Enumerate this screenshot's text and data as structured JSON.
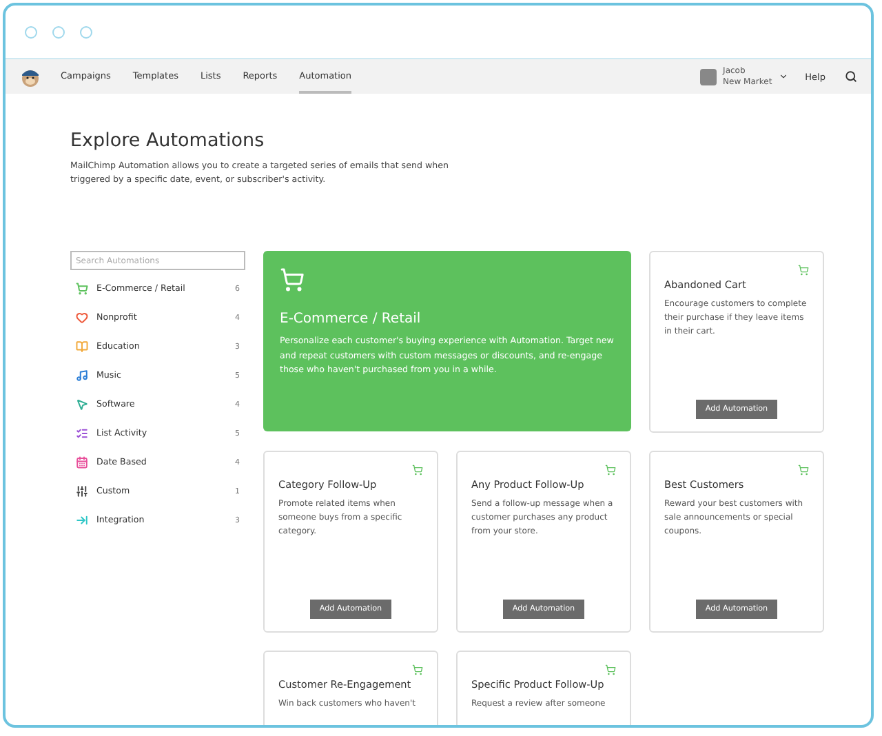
{
  "nav": {
    "items": [
      {
        "label": "Campaigns",
        "selected": false
      },
      {
        "label": "Templates",
        "selected": false
      },
      {
        "label": "Lists",
        "selected": false
      },
      {
        "label": "Reports",
        "selected": false
      },
      {
        "label": "Automation",
        "selected": true
      }
    ],
    "user": {
      "name": "Jacob",
      "org": "New Market"
    },
    "help": "Help"
  },
  "page": {
    "title": "Explore Automations",
    "description": "MailChimp Automation allows you to create a targeted series of emails that send when triggered by a specific date, event, or subscriber's activity."
  },
  "sidebar": {
    "search": {
      "placeholder": "Search Automations"
    },
    "categories": [
      {
        "kind": "cart",
        "label": "E-Commerce / Retail",
        "count": "6",
        "color": "#5cc15c"
      },
      {
        "kind": "heart",
        "label": "Nonprofit",
        "count": "4",
        "color": "#ee5a3c"
      },
      {
        "kind": "book",
        "label": "Education",
        "count": "3",
        "color": "#f2a93b"
      },
      {
        "kind": "music",
        "label": "Music",
        "count": "5",
        "color": "#2a7dd6"
      },
      {
        "kind": "pointer",
        "label": "Software",
        "count": "4",
        "color": "#2fae94"
      },
      {
        "kind": "list",
        "label": "List Activity",
        "count": "5",
        "color": "#9b4fd6"
      },
      {
        "kind": "calendar",
        "label": "Date Based",
        "count": "4",
        "color": "#e84f9a"
      },
      {
        "kind": "sliders",
        "label": "Custom",
        "count": "1",
        "color": "#444444"
      },
      {
        "kind": "integration",
        "label": "Integration",
        "count": "3",
        "color": "#2fc6c6"
      }
    ]
  },
  "featured": {
    "title": "E-Commerce / Retail",
    "description": "Personalize each customer's buying experience with Automation. Target new and repeat customers with custom messages or discounts, and re-engage those who haven't purchased from you in a while."
  },
  "automations": [
    {
      "title": "Abandoned Cart",
      "description": "Encourage customers to complete their purchase if they leave items in their cart.",
      "button": "Add Automation"
    },
    {
      "title": "Category Follow-Up",
      "description": "Promote related items when someone buys from a specific category.",
      "button": "Add Automation"
    },
    {
      "title": "Any Product Follow-Up",
      "description": "Send a follow-up message when a customer purchases any product from your store.",
      "button": "Add Automation"
    },
    {
      "title": "Best Customers",
      "description": "Reward your best customers with sale announcements or special coupons.",
      "button": "Add Automation"
    },
    {
      "title": "Customer Re-Engagement",
      "description": "Win back customers who haven't"
    },
    {
      "title": "Specific Product Follow-Up",
      "description": "Request a review after someone"
    }
  ]
}
